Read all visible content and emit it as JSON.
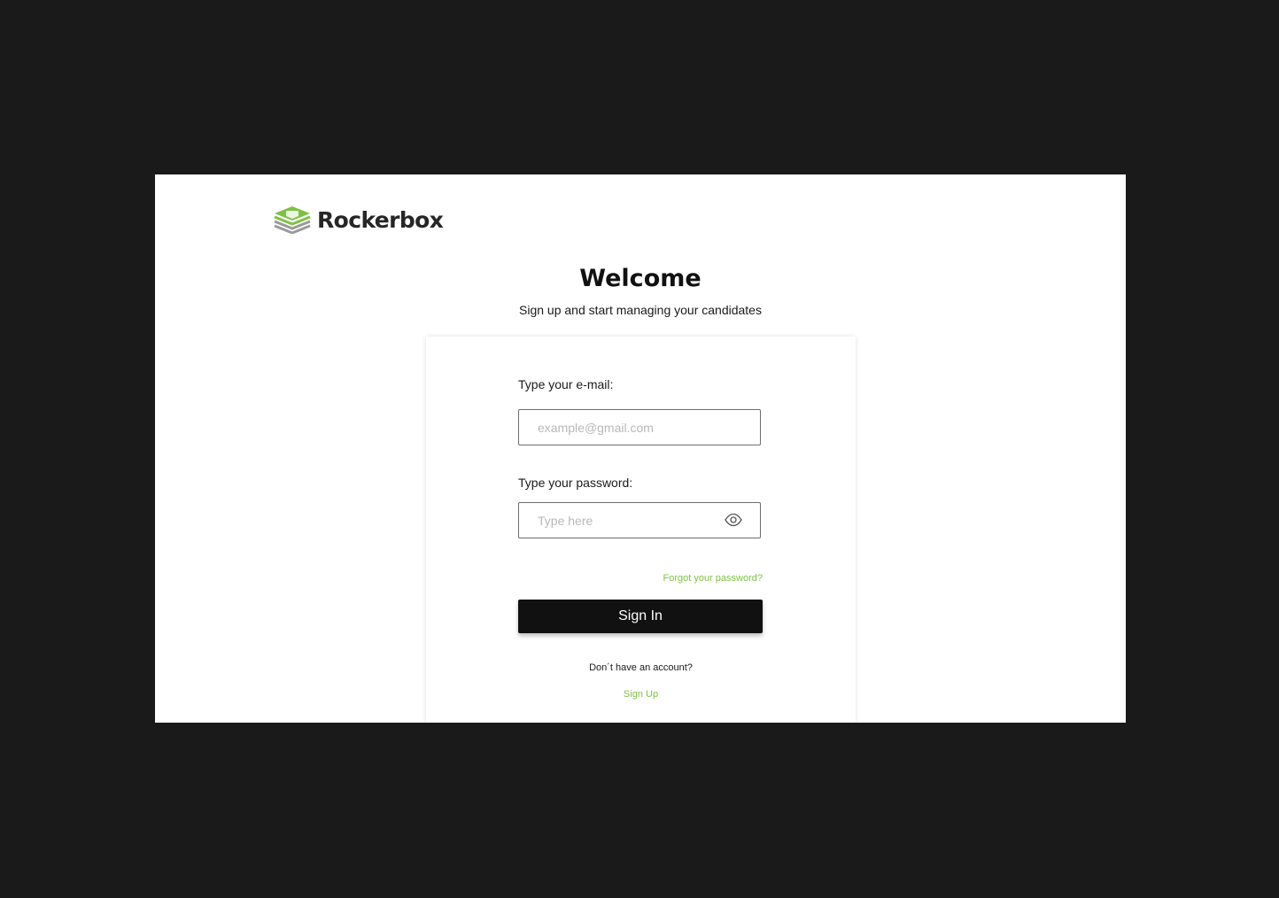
{
  "brand": {
    "name": "Rockerbox",
    "logo_icon": "stacked-layers-logo-icon",
    "accent_color": "#7cc242",
    "logo_gray": "#9a9a9a"
  },
  "header": {
    "title": "Welcome",
    "subtitle": "Sign up and start managing your candidates"
  },
  "form": {
    "email_label": "Type your e-mail:",
    "email_placeholder": "example@gmail.com",
    "email_value": "",
    "password_label": "Type your password:",
    "password_placeholder": "Type here",
    "password_value": "",
    "password_toggle_icon": "eye-icon",
    "forgot_link": "Forgot your password?",
    "submit_label": "Sign In",
    "button_color": "#111111"
  },
  "footer": {
    "no_account_text": "Don´t have an account?",
    "signup_link": "Sign Up"
  }
}
